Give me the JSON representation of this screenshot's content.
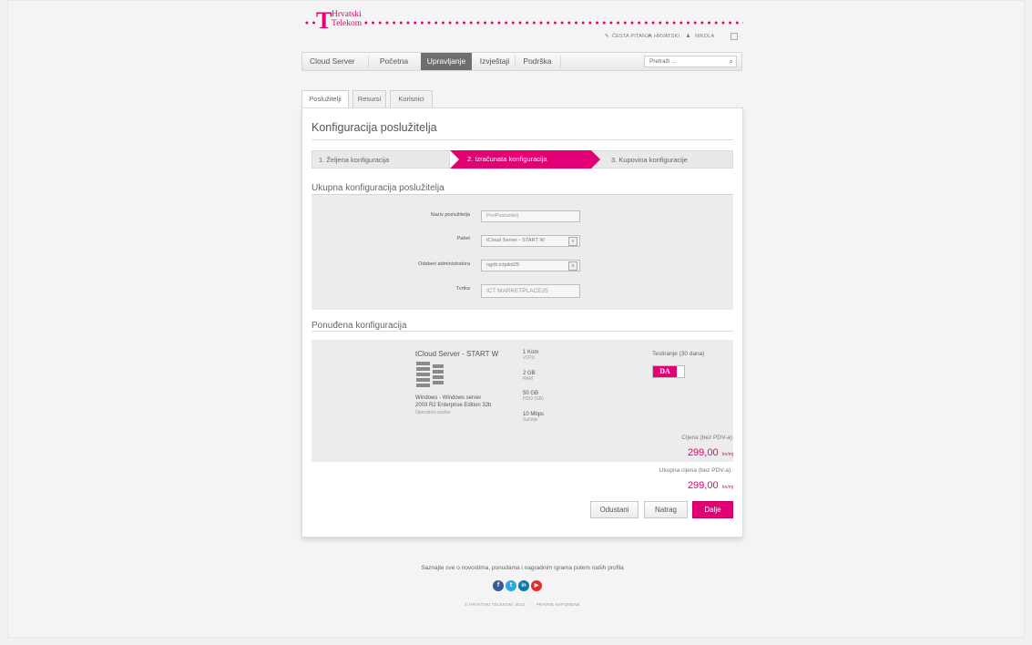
{
  "brand": {
    "logo_t": "T",
    "name_line1": "Hrvatski",
    "name_line2": "Telekom",
    "accent_color": "#e20074"
  },
  "top_links": {
    "faq": "ČESTA PITANJA",
    "language": "HRVATSKI",
    "user": "NIKOLA"
  },
  "nav": {
    "items": [
      "Cloud Server",
      "Početna",
      "Upravljanje",
      "Izvještaji",
      "Podrška"
    ],
    "active": "Upravljanje",
    "search_placeholder": "Pretraži ..."
  },
  "tabs": [
    "Poslužitelji",
    "Resursi",
    "Korisnici"
  ],
  "page_title": "Konfiguracija poslužitelja",
  "steps": [
    "1. Željena konfiguracija",
    "2. Izračunata konfiguracija",
    "3. Kupovina konfiguracije"
  ],
  "server_config": {
    "heading": "Ukupna konfiguracija poslužitelja",
    "fields": [
      {
        "label": "Naziv poslužitelja",
        "value": "PrviPosluzitelj"
      },
      {
        "label": "Paket",
        "value": "tCloud Server - START W"
      },
      {
        "label": "Odaberi administratora",
        "value": "ngrib.ictpilot25"
      },
      {
        "label": "Tvrtka",
        "value": "ICT MARKETPLACE25"
      }
    ]
  },
  "offer": {
    "heading": "Ponuđena konfiguracija",
    "package_name": "tCloud Server - START W",
    "os_line1": "Windows - Windows server",
    "os_line2": "2003 R2 Enterprise Edition 32b",
    "os_label": "Operativni sustav",
    "specs": [
      {
        "value": "1 Kom",
        "label": "vCPU"
      },
      {
        "value": "2 GB",
        "label": "RAM"
      },
      {
        "value": "50 GB",
        "label": "HDD (GB)"
      },
      {
        "value": "10 Mbps",
        "label": "Sučelje"
      }
    ],
    "testing_label": "Testiranje (30 dana)",
    "testing_toggle": "DA",
    "price_label": "Cijena (bez PDV-a)",
    "price_value": "299,00",
    "price_unit": "kn/mj"
  },
  "total": {
    "label": "Ukupna cijena (bez PDV-a):",
    "value": "299,00",
    "unit": "kn/mj"
  },
  "buttons": {
    "cancel": "Odustani",
    "back": "Natrag",
    "next": "Dalje"
  },
  "footer": {
    "text": "Saznajte sve o novostima, ponudama i nagradnim igrama putem naših profila",
    "social": [
      {
        "icon": "facebook-icon",
        "glyph": "f",
        "color": "#3b5998"
      },
      {
        "icon": "twitter-icon",
        "glyph": "t",
        "color": "#2aa9e0"
      },
      {
        "icon": "linkedin-icon",
        "glyph": "in",
        "color": "#0e76a8"
      },
      {
        "icon": "youtube-icon",
        "glyph": "▶",
        "color": "#e52d27"
      }
    ],
    "copyright": "© HRVATSKI TELEKOM, 2012",
    "legal": "PRAVNE NAPOMENE"
  }
}
